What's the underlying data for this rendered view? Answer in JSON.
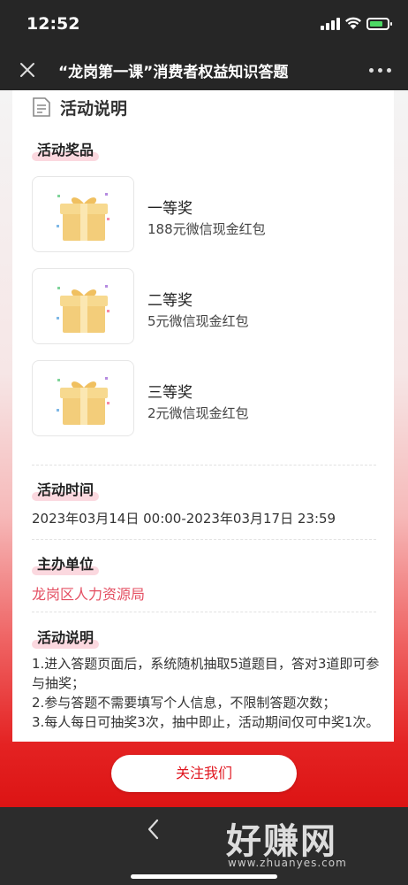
{
  "status": {
    "time": "12:52"
  },
  "nav": {
    "title": "“龙岗第一课”消费者权益知识答题"
  },
  "card": {
    "title": "活动说明",
    "prizes_label": "活动奖品",
    "prizes": [
      {
        "rank": "一等奖",
        "desc": "188元微信现金红包"
      },
      {
        "rank": "二等奖",
        "desc": "5元微信现金红包"
      },
      {
        "rank": "三等奖",
        "desc": "2元微信现金红包"
      }
    ],
    "time_label": "活动时间",
    "time_value": "2023年03月14日 00:00-2023年03月17日 23:59",
    "organizer_label": "主办单位",
    "organizer_value": "龙岗区人力资源局",
    "rules_label": "活动说明",
    "rules": [
      "1.进入答题页面后，系统随机抽取5道题目，答对3道即可参与抽奖；",
      "2.参与答题不需要填写个人信息，不限制答题次数；",
      "3.每人每日可抽奖3次，抽中即止，活动期间仅可中奖1次。"
    ]
  },
  "follow_button": "关注我们",
  "watermark": {
    "big": "好赚网",
    "small": "www.zhuanyes.com"
  },
  "colors": {
    "accent_red": "#e0161f",
    "organizer_pink": "#e44f62",
    "label_highlight": "#fbd8df"
  }
}
